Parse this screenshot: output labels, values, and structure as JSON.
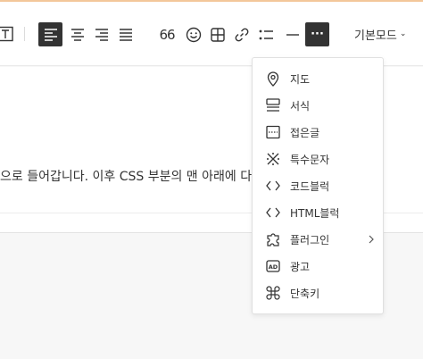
{
  "toolbar": {
    "mode_label": "기본모드",
    "quote_glyph": "66",
    "more_glyph": "···"
  },
  "editor": {
    "body_text": "으로 들어갑니다. 이후 CSS 부분의 맨 아래에 다음 코드를 추가해 주세요."
  },
  "more_menu": {
    "items": [
      {
        "label": "지도",
        "icon": "map-pin-icon"
      },
      {
        "label": "서식",
        "icon": "template-icon"
      },
      {
        "label": "접은글",
        "icon": "fold-icon"
      },
      {
        "label": "특수문자",
        "icon": "special-char-icon"
      },
      {
        "label": "코드블럭",
        "icon": "code-icon"
      },
      {
        "label": "HTML블럭",
        "icon": "html-code-icon"
      },
      {
        "label": "플러그인",
        "icon": "puzzle-icon"
      },
      {
        "label": "광고",
        "icon": "ad-icon"
      },
      {
        "label": "단축키",
        "icon": "command-icon"
      }
    ]
  },
  "colors": {
    "accent_top_line": "#f3c79a",
    "active_button_bg": "#333333"
  }
}
